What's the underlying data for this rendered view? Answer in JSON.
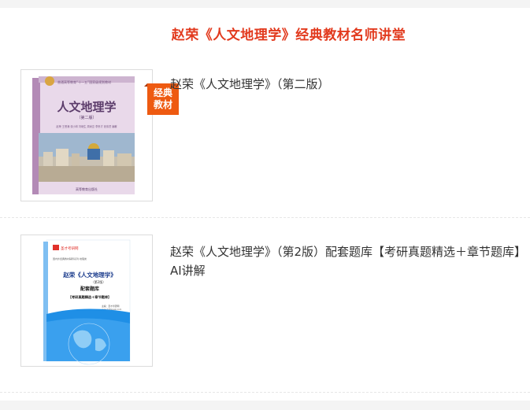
{
  "section": {
    "title": "赵荣《人文地理学》经典教材名师讲堂"
  },
  "items": [
    {
      "title": "赵荣《人文地理学》（第二版）",
      "badge_line1": "经典",
      "badge_line2": "教材",
      "cover": {
        "main_title": "人文地理学",
        "edition": "（第二版）",
        "series_text": "普通高等教育“十一五”国家级规划教材",
        "authors": "赵荣 王恩涌 张小林 刘继生 周尚意 李贵才 张伟然 编著",
        "publisher": "高等教育出版社",
        "bg_color": "#e9d9ea",
        "band_color": "#b38ab6"
      }
    },
    {
      "title": "赵荣《人文地理学》（第2版）配套题库【考研真题精选＋章节题库】",
      "title_line2": "AI讲解",
      "cover": {
        "brand": "圣才考研网",
        "series_text": "国内外经典教材辅导系列·地理类",
        "main_title": "赵荣《人文地理学》",
        "edition": "（第2版）",
        "subtitle": "配套题库",
        "bracket_line": "【考研真题精选＋章节题库】",
        "editor": "主编：圣才考研网",
        "site": "www.100xuexi.com",
        "accent": "#1f8fe6",
        "spine": "#7fbff2"
      }
    }
  ]
}
